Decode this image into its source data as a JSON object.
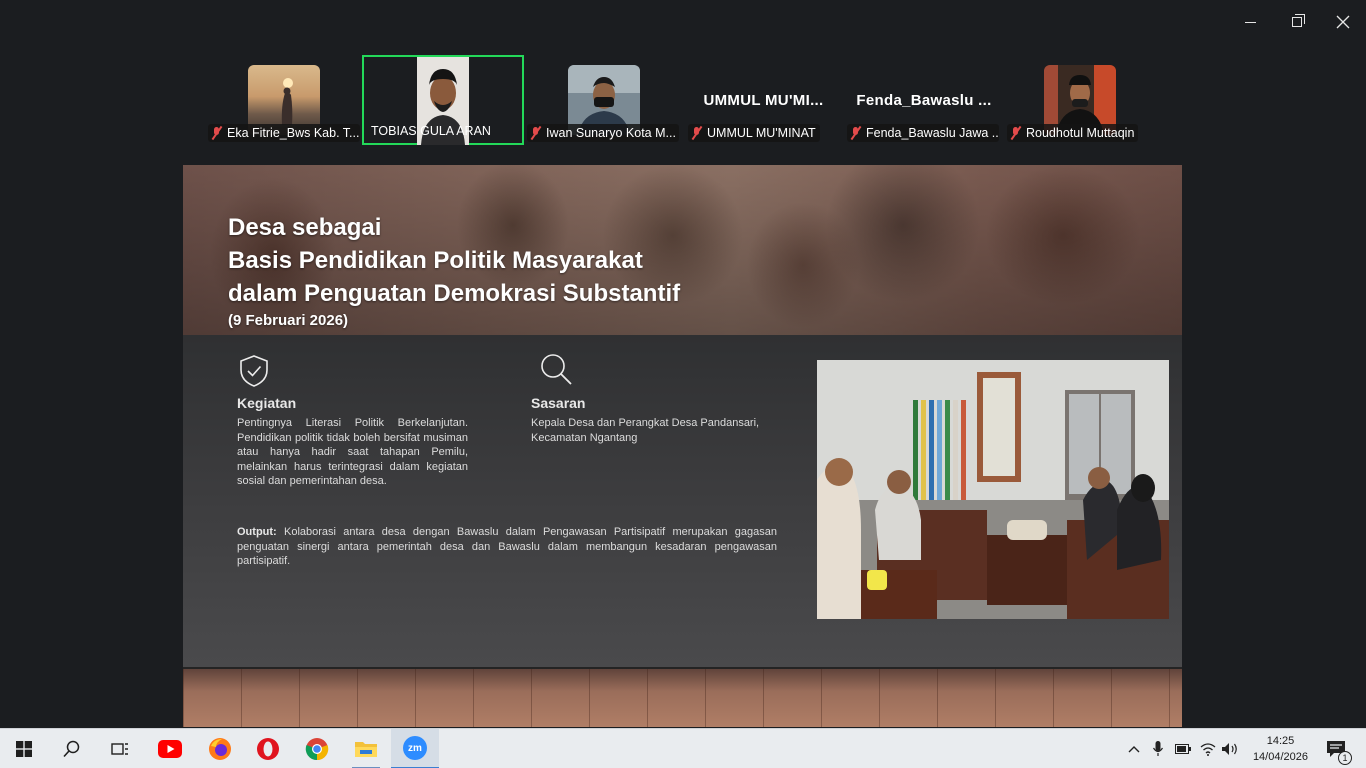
{
  "participants": [
    {
      "name": "Eka Fitrie_Bws Kab. T...",
      "muted": true,
      "has_video": true
    },
    {
      "name": "TOBIAS GULA ARAN",
      "muted": false,
      "has_video": true,
      "active_speaker": true
    },
    {
      "name": "Iwan Sunaryo Kota M...",
      "muted": true,
      "has_video": true
    },
    {
      "name": "UMMUL MU'MINAT",
      "display_name": "UMMUL  MU'MI...",
      "muted": true,
      "has_video": false
    },
    {
      "name": "Fenda_Bawaslu Jawa ...",
      "display_name": "Fenda_Bawaslu ...",
      "muted": true,
      "has_video": false
    },
    {
      "name": "Roudhotul Muttaqin",
      "muted": true,
      "has_video": true
    }
  ],
  "slide": {
    "title_lines": [
      "Desa sebagai",
      "Basis Pendidikan Politik Masyarakat",
      "dalam Penguatan Demokrasi Substantif"
    ],
    "date": "(9 Februari 2026)",
    "kegiatan": {
      "icon": "shield-check-icon",
      "title": "Kegiatan",
      "text": "Pentingnya Literasi Politik Berkelanjutan. Pendidikan politik tidak boleh bersifat musiman atau hanya hadir saat tahapan Pemilu, melainkan harus terintegrasi dalam kegiatan sosial dan pemerintahan desa."
    },
    "sasaran": {
      "icon": "magnifier-icon",
      "title": "Sasaran",
      "text": "Kepala Desa dan Perangkat Desa Pandansari, Kecamatan Ngantang"
    },
    "output": {
      "label": "Output:",
      "text": "Kolaborasi antara desa dengan Bawaslu dalam Pengawasan Partisipatif merupakan gagasan penguatan sinergi antara pemerintah desa dan Bawaslu dalam membangun kesadaran pengawasan partisipatif."
    }
  },
  "taskbar": {
    "apps": [
      "windows-start-icon",
      "search-icon",
      "task-view-icon",
      "youtube-icon",
      "firefox-icon",
      "opera-icon",
      "chrome-icon",
      "file-explorer-icon",
      "zoom-icon"
    ],
    "zoom_label": "zm",
    "time": "14:25",
    "date": "14/04/2026",
    "notification_count": "1"
  }
}
